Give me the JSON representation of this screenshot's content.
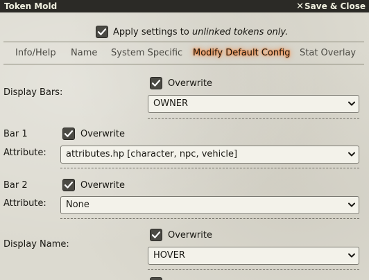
{
  "window": {
    "title": "Token Mold",
    "close_label": "Save & Close"
  },
  "apply": {
    "label_prefix": "Apply settings to ",
    "label_emphasis": "unlinked tokens only.",
    "checked": true
  },
  "tabs": [
    {
      "label": "Info/Help",
      "active": false
    },
    {
      "label": "Name",
      "active": false
    },
    {
      "label": "System Specific",
      "active": false
    },
    {
      "label": "Modify Default Config",
      "active": true
    },
    {
      "label": "Stat Overlay",
      "active": false
    }
  ],
  "settings": {
    "display_bars": {
      "label": "Display Bars:",
      "overwrite_label": "Overwrite",
      "value": "OWNER"
    },
    "bar1": {
      "label": "Bar 1",
      "overwrite_label": "Overwrite",
      "attribute_label": "Attribute:",
      "value": "attributes.hp [character, npc, vehicle]"
    },
    "bar2": {
      "label": "Bar 2",
      "overwrite_label": "Overwrite",
      "attribute_label": "Attribute:",
      "value": "None"
    },
    "display_name": {
      "label": "Display Name:",
      "overwrite_label": "Overwrite",
      "value": "HOVER"
    }
  },
  "colors": {
    "titlebar": "#2b2a26",
    "active_tab_glow": "#ff6400",
    "checkbox": "#4b4a44"
  }
}
